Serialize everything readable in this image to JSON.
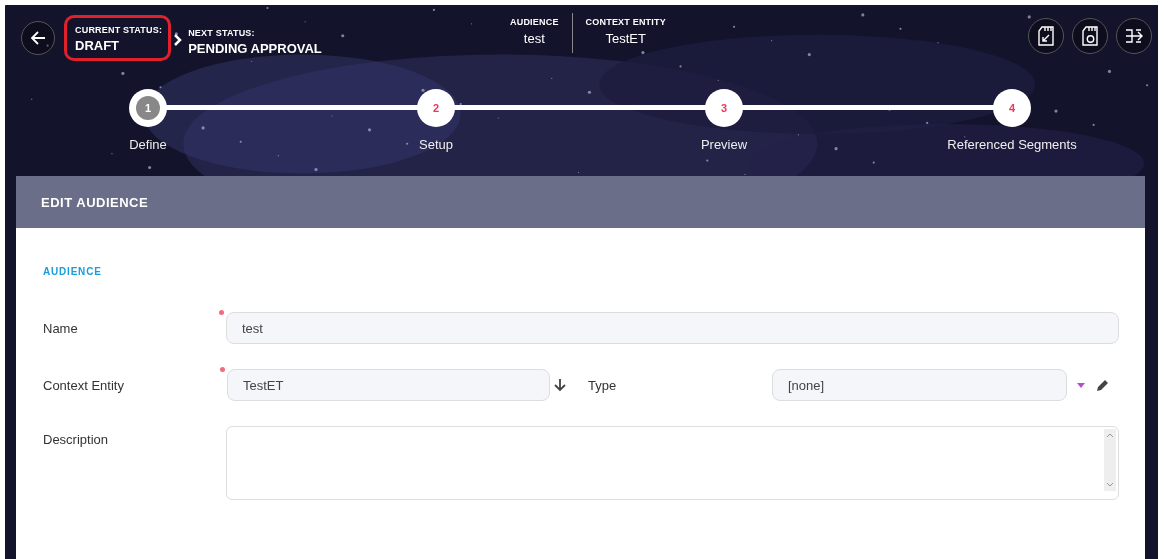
{
  "header": {
    "current_status": {
      "label": "CURRENT STATUS:",
      "value": "DRAFT",
      "highlighted": true
    },
    "next_status": {
      "label": "NEXT STATUS:",
      "value": "PENDING APPROVAL"
    },
    "info": [
      {
        "label": "AUDIENCE",
        "value": "test"
      },
      {
        "label": "CONTEXT ENTITY",
        "value": "TestET"
      }
    ]
  },
  "steps": [
    {
      "number": "1",
      "label": "Define",
      "selected": true
    },
    {
      "number": "2",
      "label": "Setup",
      "selected": false
    },
    {
      "number": "3",
      "label": "Preview",
      "selected": false
    },
    {
      "number": "4",
      "label": "Referenced Segments",
      "selected": false
    }
  ],
  "panel": {
    "title": "EDIT AUDIENCE",
    "section": "AUDIENCE",
    "fields": {
      "name": {
        "label": "Name",
        "value": "test",
        "required": true
      },
      "context_entity": {
        "label": "Context Entity",
        "value": "TestET",
        "required": true
      },
      "type": {
        "label": "Type",
        "value": "[none]"
      },
      "description": {
        "label": "Description"
      }
    }
  }
}
